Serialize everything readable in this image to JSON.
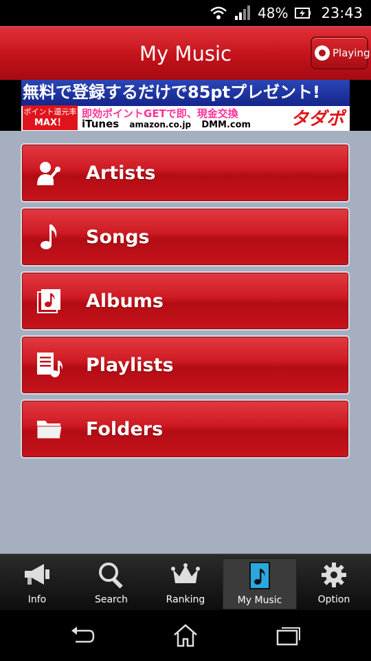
{
  "status_bar": {
    "battery": "48%",
    "time": "23:43"
  },
  "header": {
    "title": "My Music",
    "playing_label": "Playing"
  },
  "banner": {
    "headline": "無料で登録するだけで85ptプレゼント!",
    "badge_top": "ポイント還元率",
    "badge_bottom": "MAX！",
    "subline": "即効ポイントGETで即、現金交換",
    "partners": [
      "iTunes",
      "amazon.co.jp",
      "DMM.com"
    ],
    "logo": "タダポ"
  },
  "menu": {
    "items": [
      {
        "label": "Artists",
        "icon": "singer-icon"
      },
      {
        "label": "Songs",
        "icon": "music-note-icon"
      },
      {
        "label": "Albums",
        "icon": "album-icon"
      },
      {
        "label": "Playlists",
        "icon": "playlist-icon"
      },
      {
        "label": "Folders",
        "icon": "folder-icon"
      }
    ]
  },
  "tabs": [
    {
      "label": "Info",
      "icon": "megaphone-icon"
    },
    {
      "label": "Search",
      "icon": "magnifier-icon"
    },
    {
      "label": "Ranking",
      "icon": "crown-icon"
    },
    {
      "label": "My Music",
      "icon": "music-note-icon",
      "active": true
    },
    {
      "label": "Option",
      "icon": "gear-icon"
    }
  ],
  "colors": {
    "accent_red": "#c4121b",
    "content_bg": "#a6afbf",
    "tab_active_icon": "#29a8e0"
  }
}
